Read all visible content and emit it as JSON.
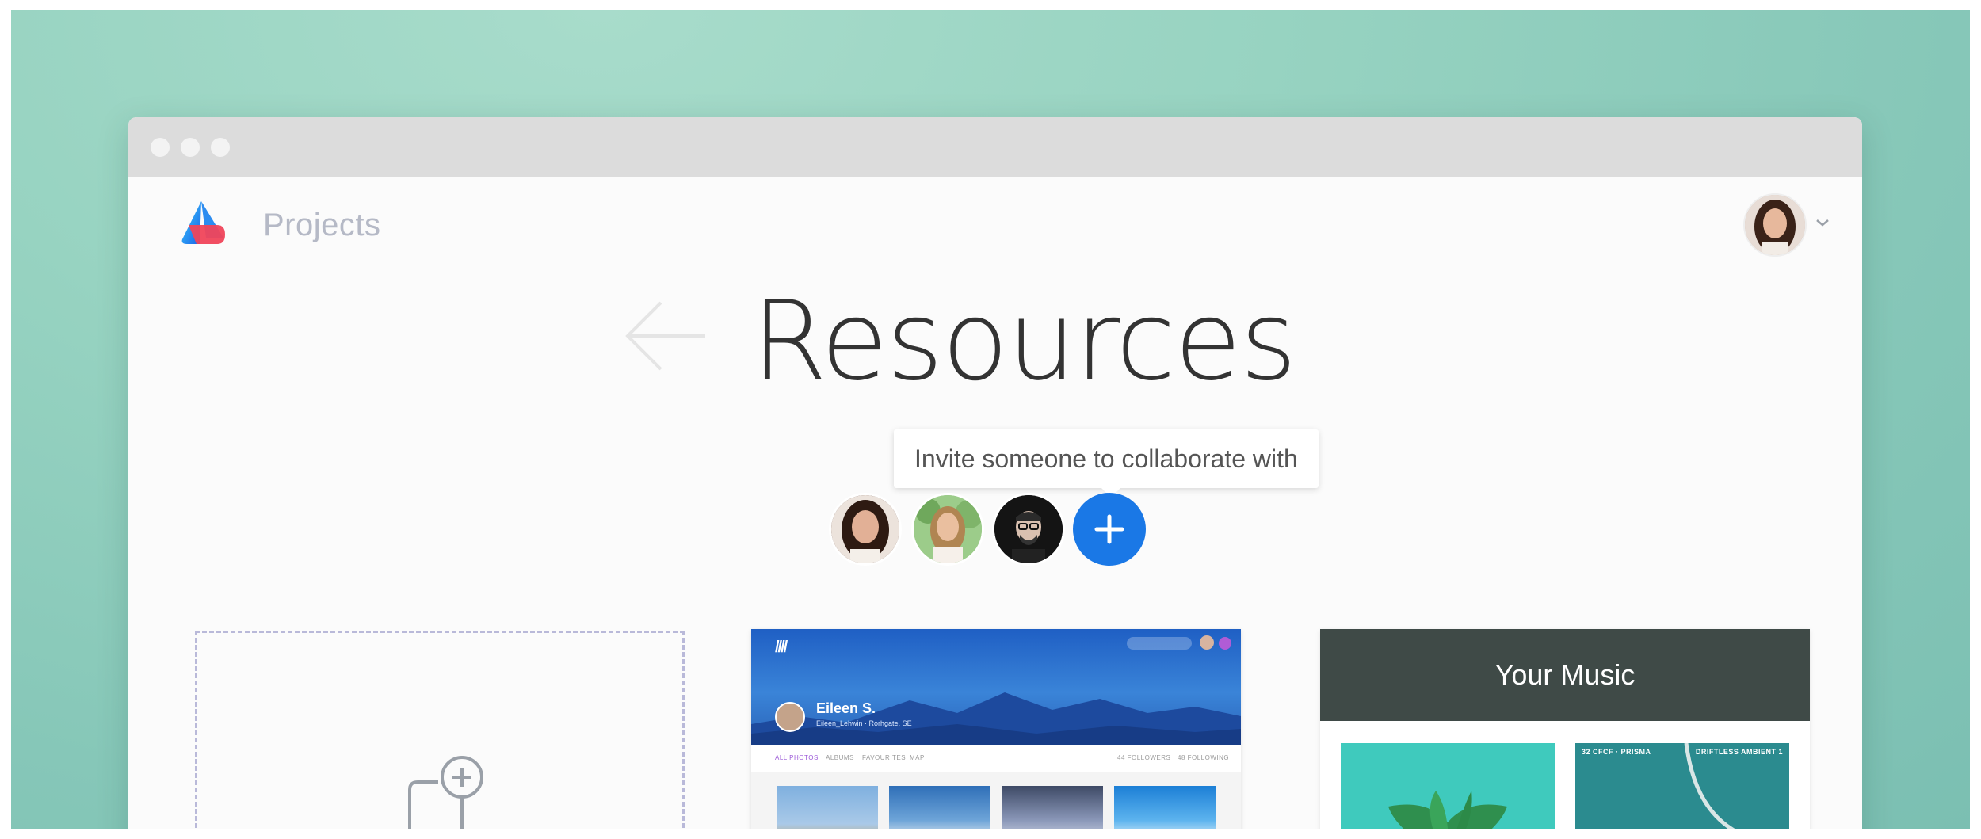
{
  "app": {
    "title": "Projects"
  },
  "page": {
    "title": "Resources"
  },
  "collaborators": {
    "tooltip": "Invite someone to collaborate with"
  },
  "cards": {
    "photos": {
      "user_name": "Eileen S.",
      "user_subtitle": "Eileen_Lehwin · Rorhgate, SE",
      "tabs": [
        "ALL PHOTOS",
        "ALBUMS",
        "FAVOURITES",
        "MAP"
      ],
      "right_tabs": [
        "44 FOLLOWERS",
        "48 FOLLOWING"
      ]
    },
    "music": {
      "title": "Your Music",
      "album2_left": "32 CFCF · PRISMA",
      "album2_right": "DRIFTLESS AMBIENT 1"
    }
  },
  "colors": {
    "accent": "#1a78e6",
    "music_header": "#3f4a47",
    "backdrop": "#97d3c1",
    "titlebar": "#dcdcdc"
  },
  "icons": {
    "back": "arrow-left-icon",
    "add": "plus-icon",
    "chevron": "chevron-down-icon",
    "new_doc": "document-plus-icon"
  }
}
